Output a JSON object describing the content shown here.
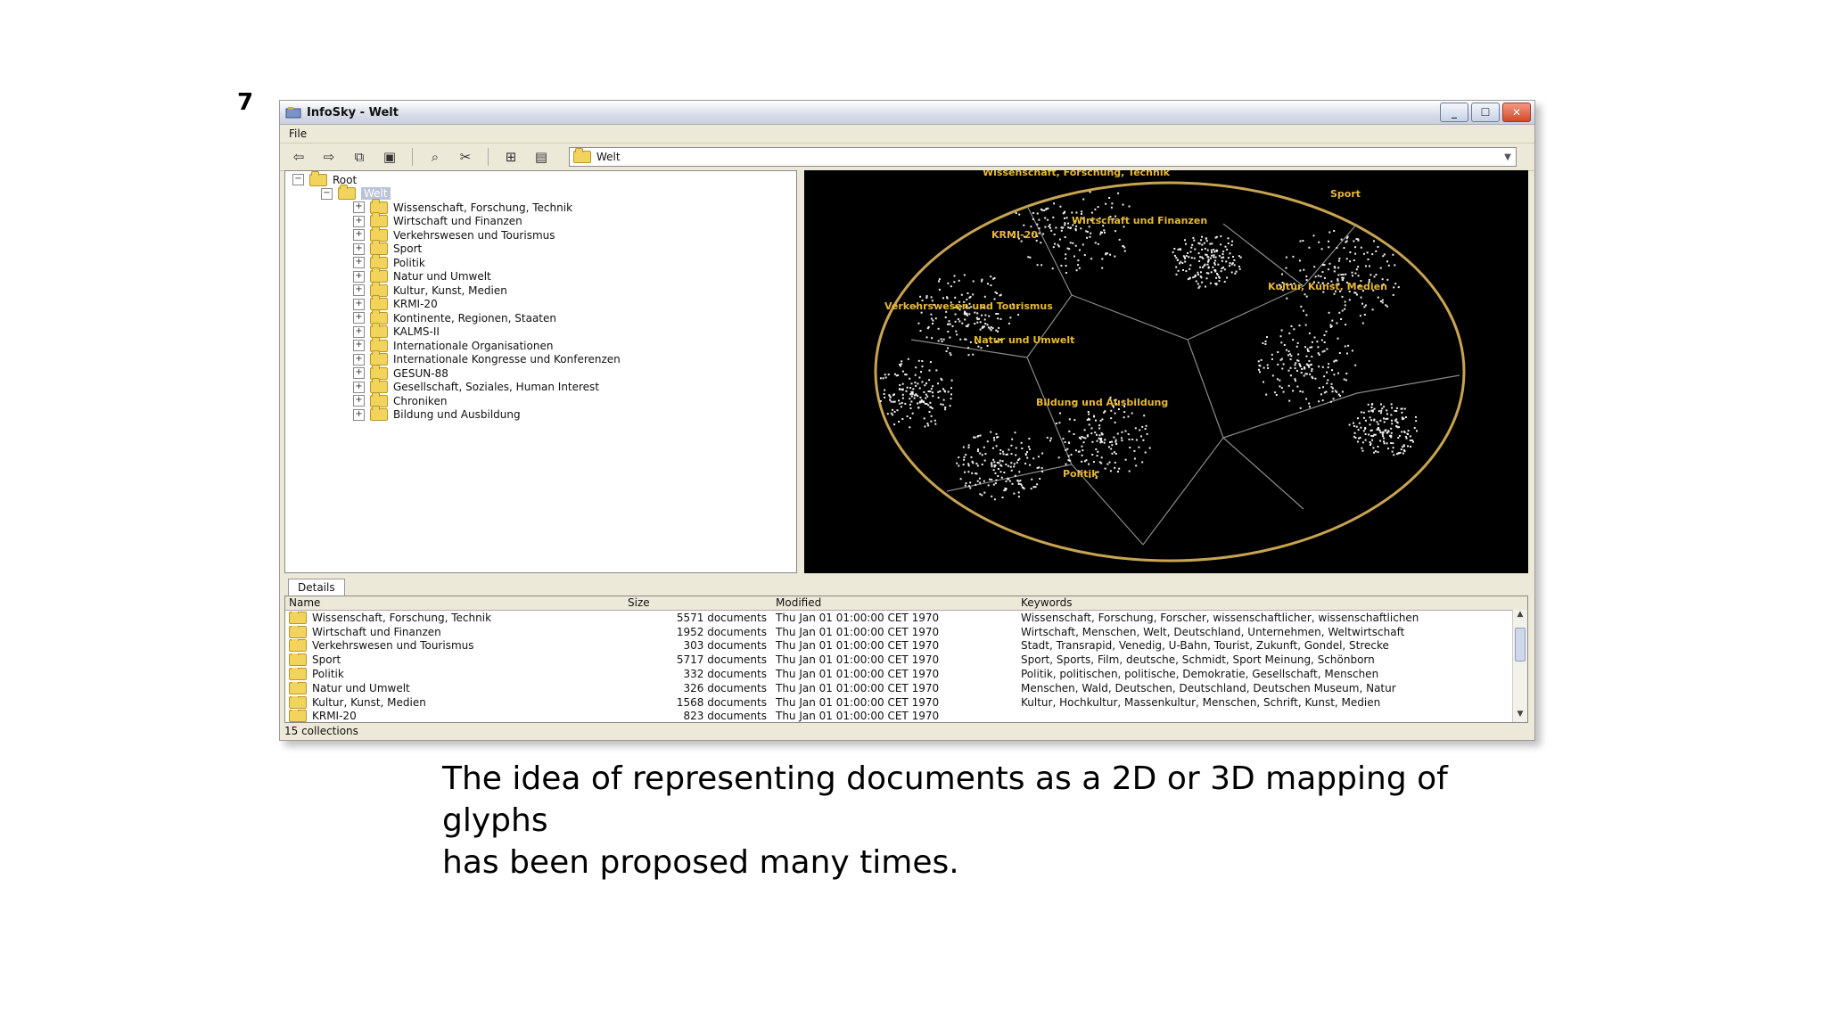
{
  "slide": {
    "mark": "7"
  },
  "window": {
    "title": "InfoSky - Welt",
    "min_glyph": "_",
    "max_glyph": "☐",
    "close_glyph": "✕"
  },
  "menu": {
    "file": "File"
  },
  "toolbar": {
    "path": "Welt"
  },
  "tree": {
    "root": "Root",
    "selected": "Welt",
    "items": [
      "Wissenschaft, Forschung, Technik",
      "Wirtschaft und Finanzen",
      "Verkehrswesen und Tourismus",
      "Sport",
      "Politik",
      "Natur und Umwelt",
      "Kultur, Kunst, Medien",
      "KRMI-20",
      "Kontinente, Regionen, Staaten",
      "KALMS-II",
      "Internationale Organisationen",
      "Internationale Kongresse und Konferenzen",
      "GESUN-88",
      "Gesellschaft, Soziales, Human Interest",
      "Chroniken",
      "Bildung und Ausbildung"
    ]
  },
  "map_labels": [
    "Wissenschaft, Forschung, Technik",
    "Sport",
    "Wirtschaft und Finanzen",
    "KRMI-20",
    "Kultur, Kunst, Medien",
    "Verkehrswesen und Tourismus",
    "Natur und Umwelt",
    "Bildung und Ausbildung",
    "Politik"
  ],
  "details": {
    "tab": "Details",
    "columns": [
      "Name",
      "Size",
      "Modified",
      "Keywords"
    ],
    "rows": [
      {
        "name": "Wissenschaft, Forschung, Technik",
        "size": "5571 documents",
        "modified": "Thu Jan 01 01:00:00 CET 1970",
        "keywords": "Wissenschaft, Forschung, Forscher, wissenschaftlicher, wissenschaftlichen"
      },
      {
        "name": "Wirtschaft und Finanzen",
        "size": "1952 documents",
        "modified": "Thu Jan 01 01:00:00 CET 1970",
        "keywords": "Wirtschaft, Menschen, Welt, Deutschland, Unternehmen, Weltwirtschaft"
      },
      {
        "name": "Verkehrswesen und Tourismus",
        "size": "303 documents",
        "modified": "Thu Jan 01 01:00:00 CET 1970",
        "keywords": "Stadt, Transrapid, Venedig, U-Bahn, Tourist, Zukunft, Gondel, Strecke"
      },
      {
        "name": "Sport",
        "size": "5717 documents",
        "modified": "Thu Jan 01 01:00:00 CET 1970",
        "keywords": "Sport, Sports, Film, deutsche, Schmidt, Sport Meinung, Schönborn"
      },
      {
        "name": "Politik",
        "size": "332 documents",
        "modified": "Thu Jan 01 01:00:00 CET 1970",
        "keywords": "Politik, politischen, politische, Demokratie, Gesellschaft, Menschen"
      },
      {
        "name": "Natur und Umwelt",
        "size": "326 documents",
        "modified": "Thu Jan 01 01:00:00 CET 1970",
        "keywords": "Menschen, Wald, Deutschen, Deutschland, Deutschen Museum, Natur"
      },
      {
        "name": "Kultur, Kunst, Medien",
        "size": "1568 documents",
        "modified": "Thu Jan 01 01:00:00 CET 1970",
        "keywords": "Kultur, Hochkultur, Massenkultur, Menschen, Schrift, Kunst, Medien"
      },
      {
        "name": "KRMI-20",
        "size": "823 documents",
        "modified": "Thu Jan 01 01:00:00 CET 1970",
        "keywords": ""
      }
    ]
  },
  "status": {
    "text": "15 collections"
  },
  "caption": {
    "line1": "The idea of representing documents as a 2D or 3D mapping of",
    "line2": "glyphs",
    "line3": "has been proposed many times."
  },
  "colors": {
    "map_label": "#e8b830",
    "map_bg": "#000000",
    "folder": "#f2d45c",
    "selection": "#b9c4d8"
  }
}
